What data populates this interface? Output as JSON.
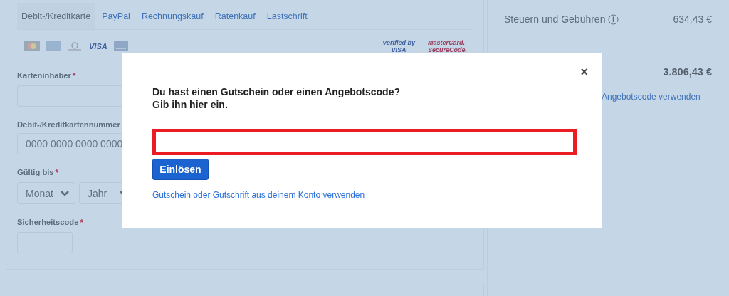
{
  "tabs": [
    {
      "label": "Debit-/Kreditkarte",
      "selected": true
    },
    {
      "label": "PayPal",
      "selected": false
    },
    {
      "label": "Rechnungskauf",
      "selected": false
    },
    {
      "label": "Ratenkauf",
      "selected": false
    },
    {
      "label": "Lastschrift",
      "selected": false
    }
  ],
  "card_logos": {
    "visa": "VISA",
    "verified": [
      "Verified",
      "by",
      "VISA"
    ],
    "securecode": [
      "MasterCard.",
      "SecureCode."
    ]
  },
  "fields": [
    {
      "kind": "text",
      "label": "Karteninhaber",
      "required_mark": "*"
    },
    {
      "kind": "text",
      "label": "Debit-/Kreditkartennummer",
      "placeholder": "0000 0000 0000 0000"
    },
    {
      "kind": "selects",
      "label": "Gültig bis",
      "required_mark": "*",
      "options": [
        "Monat",
        "Jahr"
      ]
    },
    {
      "kind": "short",
      "label": "Sicherheitscode",
      "required_mark": "*"
    }
  ],
  "summary": {
    "fee_label": "Steuern und Gebühren",
    "fee_value": "634,43 €",
    "total": "3.806,43 €",
    "link": "Angebotscode verwenden"
  },
  "modal": {
    "title_lines": [
      "Du hast einen Gutschein oder einen Angebotscode?",
      "Gib ihn hier ein."
    ],
    "close": "×",
    "button": "Einlösen",
    "link": "Gutschein oder Gutschrift aus deinem Konto verwenden",
    "highlighted": true
  }
}
